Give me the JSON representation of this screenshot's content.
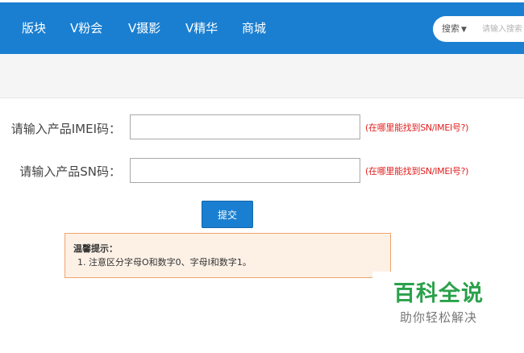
{
  "nav": {
    "items": [
      "版块",
      "V粉会",
      "V摄影",
      "V精华",
      "商城"
    ],
    "search_type": "搜索",
    "search_placeholder": "请输入搜索",
    "bg_color": "#1a7fd1"
  },
  "form": {
    "imei_label": "请输入产品IMEI码：",
    "sn_label": "请输入产品SN码：",
    "imei_value": "",
    "sn_value": "",
    "imei_help": "(在哪里能找到SN/IMEI号?)",
    "sn_help": "(在哪里能找到SN/IMEI号?)",
    "submit_label": "提交"
  },
  "tips": {
    "title": "温馨提示：",
    "items": [
      "1. 注意区分字母O和数字0、字母I和数字1。"
    ]
  },
  "watermark": {
    "title": "百科全说",
    "subtitle": "助你轻松解决"
  }
}
